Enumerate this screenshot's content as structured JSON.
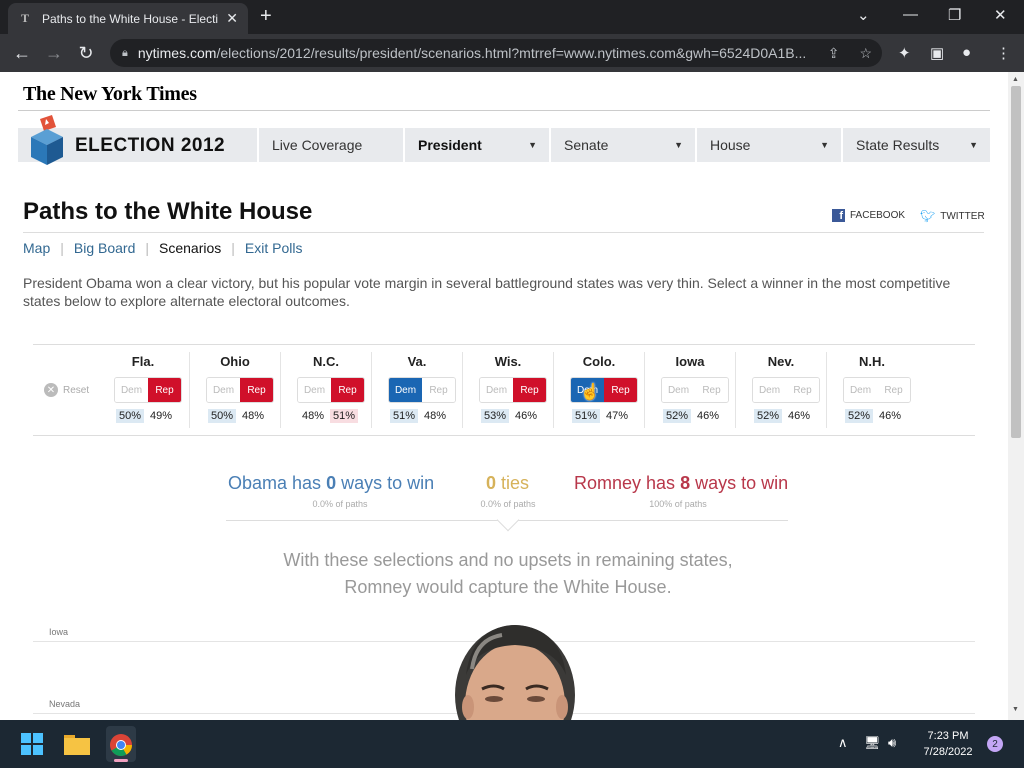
{
  "browser": {
    "tab_title": "Paths to the White House - Electi",
    "tab_favicon": "T",
    "url_domain": "nytimes.com",
    "url_path": "/elections/2012/results/president/scenarios.html?mtrref=www.nytimes.com&gwh=6524D0A1B..."
  },
  "site": {
    "logo": "The New York Times",
    "section_title": "ELECTION 2012",
    "nav": [
      {
        "label": "Live Coverage",
        "dropdown": false,
        "active": false
      },
      {
        "label": "President",
        "dropdown": true,
        "active": true
      },
      {
        "label": "Senate",
        "dropdown": true,
        "active": false
      },
      {
        "label": "House",
        "dropdown": true,
        "active": false
      },
      {
        "label": "State Results",
        "dropdown": true,
        "active": false
      }
    ]
  },
  "page": {
    "title": "Paths to the White House",
    "facebook": "FACEBOOK",
    "twitter": "TWITTER",
    "subnav": [
      "Map",
      "Big Board",
      "Scenarios",
      "Exit Polls"
    ],
    "intro": "President Obama won a clear victory, but his popular vote margin in several battleground states was very thin. Select a winner in the most competitive states below to explore alternate electoral outcomes."
  },
  "scenarios": {
    "reset_label": "Reset",
    "dem_label": "Dem",
    "rep_label": "Rep",
    "states": [
      {
        "name": "Fla.",
        "selected": "rep",
        "dem_pct": "50%",
        "rep_pct": "49%",
        "leader": "dem"
      },
      {
        "name": "Ohio",
        "selected": "rep",
        "dem_pct": "50%",
        "rep_pct": "48%",
        "leader": "dem"
      },
      {
        "name": "N.C.",
        "selected": "rep",
        "dem_pct": "48%",
        "rep_pct": "51%",
        "leader": "rep"
      },
      {
        "name": "Va.",
        "selected": "dem",
        "dem_pct": "51%",
        "rep_pct": "48%",
        "leader": "dem"
      },
      {
        "name": "Wis.",
        "selected": "rep",
        "dem_pct": "53%",
        "rep_pct": "46%",
        "leader": "dem"
      },
      {
        "name": "Colo.",
        "selected": "both",
        "dem_pct": "51%",
        "rep_pct": "47%",
        "leader": "dem"
      },
      {
        "name": "Iowa",
        "selected": "none",
        "dem_pct": "52%",
        "rep_pct": "46%",
        "leader": "dem"
      },
      {
        "name": "Nev.",
        "selected": "none",
        "dem_pct": "52%",
        "rep_pct": "46%",
        "leader": "dem"
      },
      {
        "name": "N.H.",
        "selected": "none",
        "dem_pct": "52%",
        "rep_pct": "46%",
        "leader": "dem"
      }
    ]
  },
  "outcomes": {
    "obama": {
      "prefix": "Obama has ",
      "count": "0",
      "suffix": " ways to win",
      "sub": "0.0% of paths"
    },
    "ties": {
      "count": "0",
      "suffix": " ties",
      "sub": "0.0% of paths"
    },
    "romney": {
      "prefix": "Romney has ",
      "count": "8",
      "suffix": " ways to win",
      "sub": "100% of paths"
    },
    "summary_line1": "With these selections and no upsets in remaining states,",
    "summary_line2": "Romney would capture the White House."
  },
  "timeline": [
    "Iowa",
    "Nevada"
  ],
  "taskbar": {
    "time": "7:23 PM",
    "date": "7/28/2022",
    "notifications": "2"
  },
  "colors": {
    "dem": "#1a66b3",
    "rep": "#d0102a",
    "obama_text": "#4a7fb5",
    "romney_text": "#b8374a",
    "ties_text": "#d6b25a"
  }
}
